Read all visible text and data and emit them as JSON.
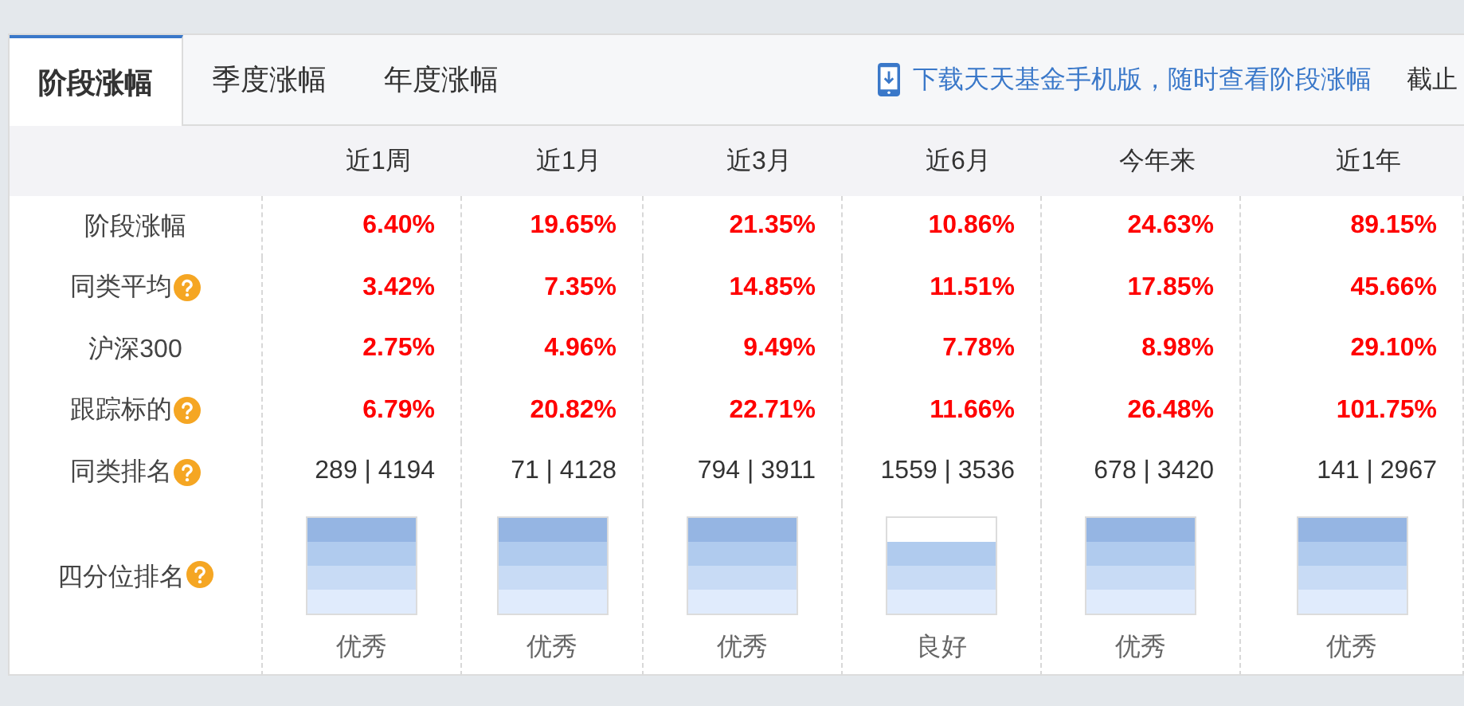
{
  "tabs": [
    {
      "label": "阶段涨幅",
      "selected": true
    },
    {
      "label": "季度涨幅",
      "selected": false
    },
    {
      "label": "年度涨幅",
      "selected": false
    }
  ],
  "notice": {
    "text": "下载天天基金手机版，随时查看阶段涨幅",
    "cutoff": "截止"
  },
  "table": {
    "columns": [
      "近1周",
      "近1月",
      "近3月",
      "近6月",
      "今年来",
      "近1年"
    ],
    "rows": [
      {
        "label": "阶段涨幅",
        "help": false,
        "kind": "percent",
        "values": [
          "6.40%",
          "19.65%",
          "21.35%",
          "10.86%",
          "24.63%",
          "89.15%"
        ]
      },
      {
        "label": "同类平均",
        "help": true,
        "kind": "percent",
        "values": [
          "3.42%",
          "7.35%",
          "14.85%",
          "11.51%",
          "17.85%",
          "45.66%"
        ]
      },
      {
        "label": "沪深300",
        "help": false,
        "kind": "percent",
        "values": [
          "2.75%",
          "4.96%",
          "9.49%",
          "7.78%",
          "8.98%",
          "29.10%"
        ]
      },
      {
        "label": "跟踪标的",
        "help": true,
        "kind": "percent",
        "values": [
          "6.79%",
          "20.82%",
          "22.71%",
          "11.66%",
          "26.48%",
          "101.75%"
        ]
      },
      {
        "label": "同类排名",
        "help": true,
        "kind": "rank",
        "values": [
          "289 | 4194",
          "71 | 4128",
          "794 | 3911",
          "1559 | 3536",
          "678 | 3420",
          "141 | 2967"
        ]
      }
    ],
    "quartile": {
      "label": "四分位排名",
      "help": true,
      "cells": [
        {
          "bands": [
            {
              "filled": true
            },
            {
              "filled": true
            },
            {
              "filled": true
            },
            {
              "filled": true
            }
          ],
          "rating": "优秀"
        },
        {
          "bands": [
            {
              "filled": true
            },
            {
              "filled": true
            },
            {
              "filled": true
            },
            {
              "filled": true
            }
          ],
          "rating": "优秀"
        },
        {
          "bands": [
            {
              "filled": true
            },
            {
              "filled": true
            },
            {
              "filled": true
            },
            {
              "filled": true
            }
          ],
          "rating": "优秀"
        },
        {
          "bands": [
            {
              "filled": false
            },
            {
              "filled": true
            },
            {
              "filled": true
            },
            {
              "filled": true
            }
          ],
          "rating": "良好"
        },
        {
          "bands": [
            {
              "filled": true
            },
            {
              "filled": true
            },
            {
              "filled": true
            },
            {
              "filled": true
            }
          ],
          "rating": "优秀"
        },
        {
          "bands": [
            {
              "filled": true
            },
            {
              "filled": true
            },
            {
              "filled": true
            },
            {
              "filled": true
            }
          ],
          "rating": "优秀"
        }
      ]
    }
  }
}
